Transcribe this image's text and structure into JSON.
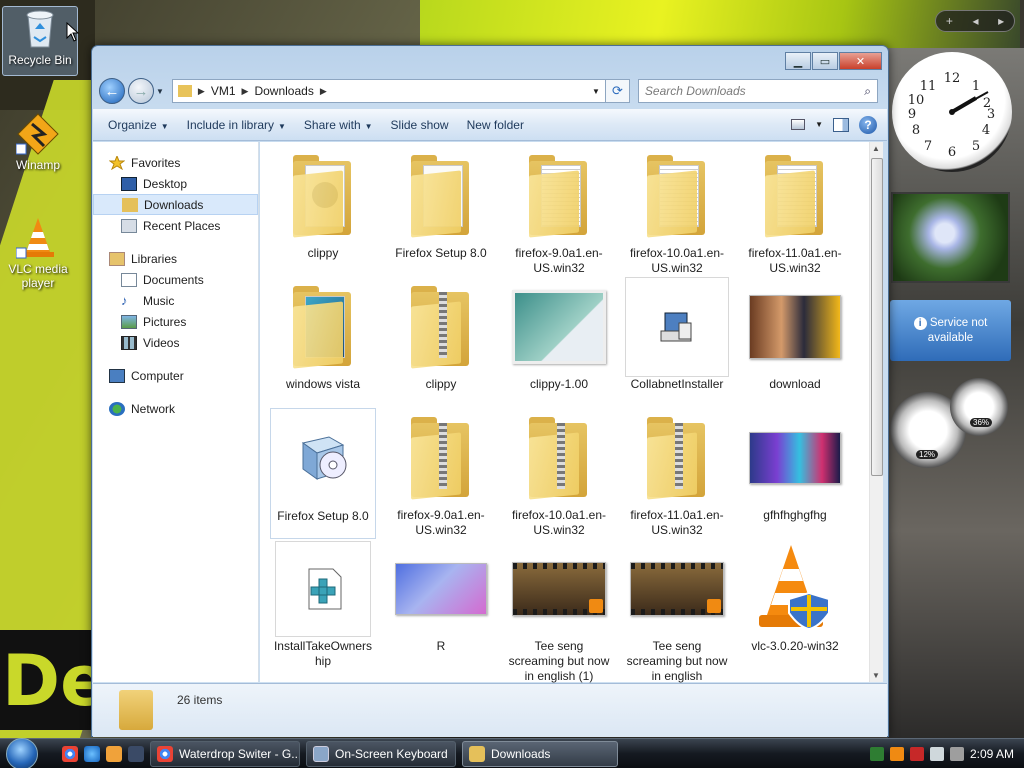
{
  "desktop": {
    "icons": [
      {
        "label": "Recycle Bin",
        "icon": "recycle-bin-icon"
      },
      {
        "label": "Winamp",
        "icon": "winamp-icon"
      },
      {
        "label": "VLC media player",
        "icon": "vlc-icon"
      }
    ]
  },
  "window": {
    "breadcrumb": [
      "VM1",
      "Downloads"
    ],
    "search_placeholder": "Search Downloads",
    "toolbar": {
      "organize": "Organize",
      "include_in_library": "Include in library",
      "share_with": "Share with",
      "slide_show": "Slide show",
      "new_folder": "New folder"
    },
    "nav": {
      "favorites": "Favorites",
      "desktop": "Desktop",
      "downloads": "Downloads",
      "recent_places": "Recent Places",
      "libraries": "Libraries",
      "documents": "Documents",
      "music": "Music",
      "pictures": "Pictures",
      "videos": "Videos",
      "computer": "Computer",
      "network": "Network"
    },
    "files": [
      {
        "name": "clippy",
        "type": "folder"
      },
      {
        "name": "Firefox Setup 8.0",
        "type": "folder"
      },
      {
        "name": "firefox-9.0a1.en-US.win32",
        "type": "folder"
      },
      {
        "name": "firefox-10.0a1.en-US.win32",
        "type": "folder"
      },
      {
        "name": "firefox-11.0a1.en-US.win32",
        "type": "folder"
      },
      {
        "name": "windows vista",
        "type": "folder"
      },
      {
        "name": "clippy",
        "type": "zip"
      },
      {
        "name": "clippy-1.00",
        "type": "image"
      },
      {
        "name": "CollabnetInstaller",
        "type": "exe"
      },
      {
        "name": "download",
        "type": "image"
      },
      {
        "name": "Firefox Setup 8.0",
        "type": "exe"
      },
      {
        "name": "firefox-9.0a1.en-US.win32",
        "type": "zip"
      },
      {
        "name": "firefox-10.0a1.en-US.win32",
        "type": "zip"
      },
      {
        "name": "firefox-11.0a1.en-US.win32",
        "type": "zip"
      },
      {
        "name": "gfhfhghgfhg",
        "type": "image"
      },
      {
        "name": "InstallTakeOwnership",
        "type": "reg"
      },
      {
        "name": "R",
        "type": "image"
      },
      {
        "name": "Tee seng screaming but now in english (1)",
        "type": "video"
      },
      {
        "name": "Tee seng screaming but now in english",
        "type": "video"
      },
      {
        "name": "vlc-3.0.20-win32",
        "type": "vlc"
      }
    ],
    "status": "26 items"
  },
  "gadgets": {
    "weather": "Service not available",
    "cpu": "12%",
    "ram": "36%"
  },
  "taskbar": {
    "tasks": [
      "Waterdrop Switer - G...",
      "On-Screen Keyboard",
      "Downloads"
    ],
    "clock": "2:09 AM"
  },
  "colors": {
    "window_frame": "#b9d1ea",
    "selection": "#d9e9fb",
    "wallpaper_accent": "#c9d82a"
  }
}
